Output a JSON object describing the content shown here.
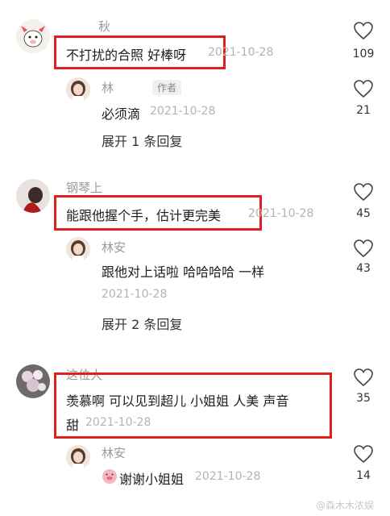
{
  "comments": [
    {
      "username": "秋",
      "text": "不打扰的合照 好棒呀",
      "date": "2021-10-28",
      "likes": "109",
      "reply": {
        "username": "林",
        "author_tag": "作者",
        "text": "必须滴",
        "date": "2021-10-28",
        "likes": "21"
      },
      "expand_label": "展开 1 条回复"
    },
    {
      "username": "钢琴上",
      "text": "能跟他握个手，估计更完美",
      "date": "2021-10-28",
      "likes": "45",
      "reply": {
        "username": "林安",
        "text": "跟他对上话啦 哈哈哈哈 一样",
        "date": "2021-10-28",
        "likes": "43"
      },
      "expand_label": "展开 2 条回复"
    },
    {
      "username": "这位大",
      "text_line1": "羡慕啊 可以见到超儿 小姐姐 人美 声音",
      "text_line2": "甜",
      "date": "2021-10-28",
      "likes": "35",
      "reply": {
        "username": "林安",
        "text": "谢谢小姐姐",
        "date": "2021-10-28",
        "likes": "14"
      }
    }
  ],
  "watermark": "@森木木浓娱",
  "colors": {
    "highlight": "#e0201c",
    "muted": "#b3b3b3"
  }
}
